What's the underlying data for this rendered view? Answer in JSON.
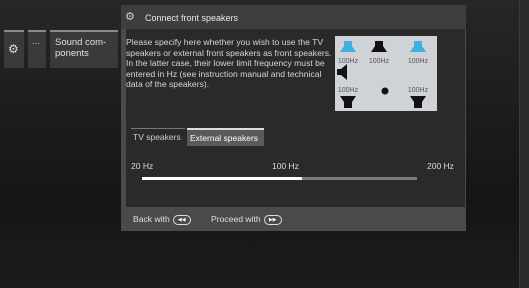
{
  "menu": {
    "gear_icon": "⚙",
    "dots_label": "...",
    "sound_label": "Sound com-\nponents"
  },
  "dialog": {
    "title": "Connect front speakers",
    "description": "Please specify here whether you wish to use the TV speakers or external front speakers as front speakers. In the latter case, their lower limit frequency must be entered in Hz (see instruction manual and technical data of the speakers).",
    "diagram": {
      "top_left_label": "100Hz",
      "top_center_label": "100Hz",
      "top_right_label": "100Hz",
      "rear_left_label": "100Hz",
      "rear_right_label": "100Hz"
    },
    "tabs": [
      {
        "label": "TV speakers",
        "selected": false
      },
      {
        "label": "External speakers",
        "selected": true
      }
    ],
    "slider": {
      "min_label": "20 Hz",
      "mid_label": "100 Hz",
      "max_label": "200 Hz",
      "value_fraction": 0.58
    },
    "footer": {
      "back_label": "Back with",
      "back_button_icon": "rewind-button",
      "proceed_label": "Proceed with",
      "proceed_button_icon": "fast-forward-button"
    }
  },
  "colors": {
    "accent_speaker": "#3fb0e0"
  }
}
